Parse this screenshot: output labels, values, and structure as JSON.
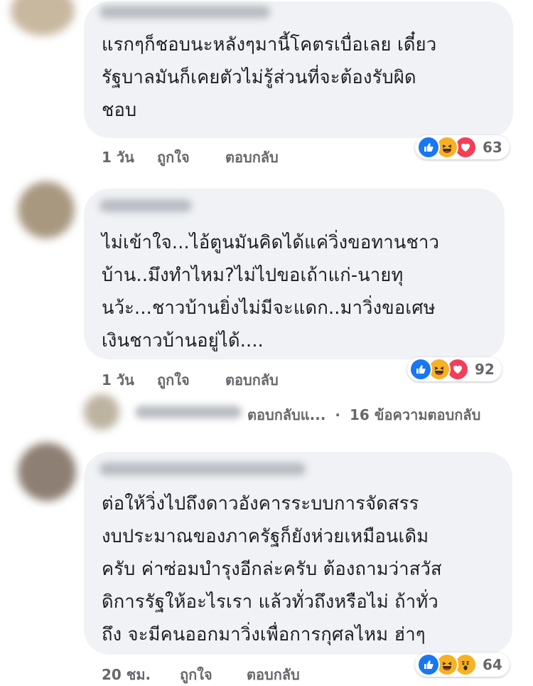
{
  "comments": [
    {
      "text": "แรกๆก็ชอบนะหลังๆมานี้โคตรเบื่อเลย เดี๋ยว\nรัฐบาลมันก็เคยตัวไม่รู้ส่วนที่จะต้องรับผิด\nชอบ",
      "time": "1 วัน",
      "like_label": "ถูกใจ",
      "reply_label": "ตอบกลับ",
      "reaction_icons": [
        "like-icon",
        "haha-icon",
        "love-icon"
      ],
      "reaction_count": "63"
    },
    {
      "text": "ไม่เข้าใจ...ไอ้ตูนมันคิดได้แค่วิ่งขอทานชาว\nบ้าน..มึงทำไหม?ไม่ไปขอเถ้าแก่-นายทุ\nนว้ะ...ชาวบ้านยิ่งไม่มีจะแดก..มาวิ่งขอเศษ\nเงินชาวบ้านอยู่ได้....",
      "time": "1 วัน",
      "like_label": "ถูกใจ",
      "reply_label": "ตอบกลับ",
      "reaction_icons": [
        "like-icon",
        "haha-icon",
        "love-icon"
      ],
      "reaction_count": "92"
    },
    {
      "text": "ต่อให้วิ่งไปถึงดาวอังคารระบบการจัดสรร\nงบประมาณของภาครัฐก็ยังห่วยเหมือนเดิม\nครับ ค่าซ่อมบำรุงอีกล่ะครับ ต้องถามว่าสวัส\nดิการรัฐให้อะไรเรา แล้วทั่วถึงหรือไม่ ถ้าทั่ว\nถึง จะมีคนออกมาวิ่งเพื่อการกุศลไหม ฮ่าๆ",
      "time": "20 ชม.",
      "like_label": "ถูกใจ",
      "reply_label": "ตอบกลับ",
      "reaction_icons": [
        "like-icon",
        "haha-icon",
        "wow-icon"
      ],
      "reaction_count": "64"
    }
  ],
  "reply_thread": {
    "text": "ตอบกลับแ...",
    "separator": "·",
    "count_text": "16 ข้อความตอบกลับ"
  },
  "colors": {
    "bubble": "#f0f2f5",
    "meta": "#65676b",
    "like": "#1877f2",
    "love": "#f33e58",
    "haha": "#f7b125"
  }
}
